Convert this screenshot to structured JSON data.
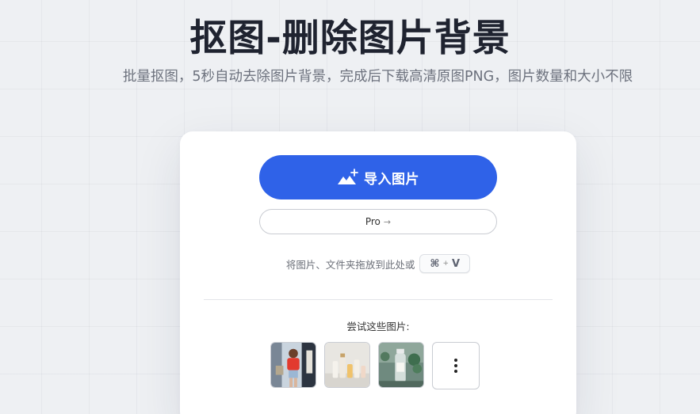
{
  "header": {
    "title": "抠图-删除图片背景",
    "subtitle": "批量抠图，5秒自动去除图片背景，完成后下载高清原图PNG，图片数量和大小不限"
  },
  "card": {
    "import_button": {
      "label": "导入图片",
      "icon": "image-add-icon"
    },
    "pro_button": {
      "label": "Pro",
      "icon": "arrow-right-icon",
      "arrow": "→"
    },
    "drop_hint": "将图片、文件夹拖放到此处或",
    "shortcut": {
      "key1": "⌘",
      "plus": "+",
      "key2": "V"
    },
    "samples_label": "尝试这些图片:",
    "samples": [
      {
        "name": "woman-red-shirt-photo"
      },
      {
        "name": "cosmetic-bottles-photo"
      },
      {
        "name": "glass-bottle-plant-photo"
      }
    ],
    "more_icon": "more-vertical-icon"
  },
  "colors": {
    "accent": "#2f62e8",
    "background": "#eef0f3",
    "title": "#1f2330"
  }
}
